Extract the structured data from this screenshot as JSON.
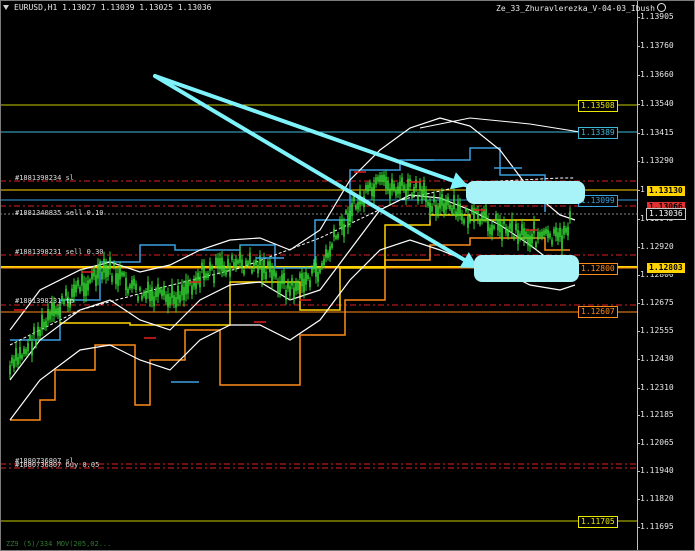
{
  "chart_header": {
    "symbol_info": "EURUSD,H1  1.13027 1.13039 1.13025 1.13036",
    "expert_name": "Ze_33_Zhuravlerezka_V-04-03_Ibush"
  },
  "price_axis": {
    "ticks": [
      "1.13905",
      "1.13760",
      "1.13660",
      "1.13540",
      "1.13415",
      "1.13290",
      "1.13170",
      "1.13045",
      "1.12920",
      "1.12800",
      "1.12675",
      "1.12555",
      "1.12430",
      "1.12310",
      "1.12185",
      "1.12065",
      "1.11940",
      "1.11820",
      "1.11695"
    ],
    "current_price": "1.13036"
  },
  "level_labels": [
    {
      "text": "1.13508",
      "color": "#e8e800",
      "style": "outlined"
    },
    {
      "text": "1.13389",
      "color": "#3fb7d6",
      "style": "outlined"
    },
    {
      "text": "1.13130",
      "color": "#ffd400",
      "style": "filled"
    },
    {
      "text": "1.13099",
      "color": "#3aa0e0",
      "style": "outlined"
    },
    {
      "text": "1.13066",
      "color": "#e03030",
      "style": "filled"
    },
    {
      "text": "1.12803",
      "color": "#ffd400",
      "style": "filled"
    },
    {
      "text": "1.12800",
      "color": "#ff8c1a",
      "style": "outlined"
    },
    {
      "text": "1.12607",
      "color": "#ff8c1a",
      "style": "outlined"
    },
    {
      "text": "1.11705",
      "color": "#e8e800",
      "style": "outlined"
    }
  ],
  "order_labels": [
    "#1881398234 sl",
    "#1881340835 sell 0.10",
    "#1881398231 sell 0.30",
    "#1881398231 tp",
    "#1880736807 sl",
    "#1880736807 buy 0.05"
  ],
  "footer_text": "ZZ9 (5)/334 MOV(205,02...",
  "colors": {
    "candles": "#33dd33",
    "bands": "#ffffff",
    "blue_channel": "#3aa0e0",
    "orange_channel": "#ff8c1a",
    "yellow_segments": "#ffd400",
    "arrows": "#7ff3fb",
    "order_lines": "#e02020"
  }
}
